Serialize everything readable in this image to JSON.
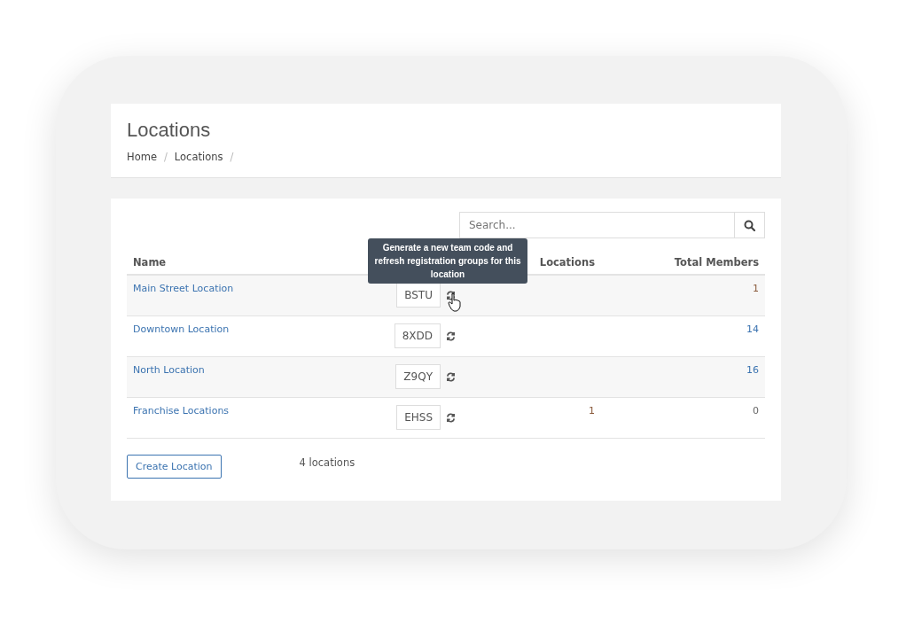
{
  "page": {
    "title": "Locations",
    "breadcrumb": [
      {
        "label": "Home",
        "separator": "/"
      },
      {
        "label": "Locations",
        "separator": "/"
      }
    ]
  },
  "search": {
    "placeholder": "Search..."
  },
  "table": {
    "columns": [
      "Name",
      "Locations",
      "Total Members"
    ],
    "rows": [
      {
        "name": "Main Street Location",
        "code": "BSTU",
        "members": "1",
        "members_link": false,
        "hovered": true
      },
      {
        "name": "Downtown Location",
        "code": "8XDD",
        "members": "14",
        "members_link": true,
        "hovered": false
      },
      {
        "name": "North Location",
        "code": "Z9QY",
        "members": "16",
        "members_link": true,
        "hovered": false
      },
      {
        "name": "Franchise Locations",
        "code": "EHSS",
        "locations": "1",
        "members": "0",
        "members_link": false,
        "hovered": false
      }
    ]
  },
  "tooltip": {
    "text": "Generate a new team code and refresh registration groups for this location"
  },
  "create_button": "Create Location",
  "count": "4 locations"
}
